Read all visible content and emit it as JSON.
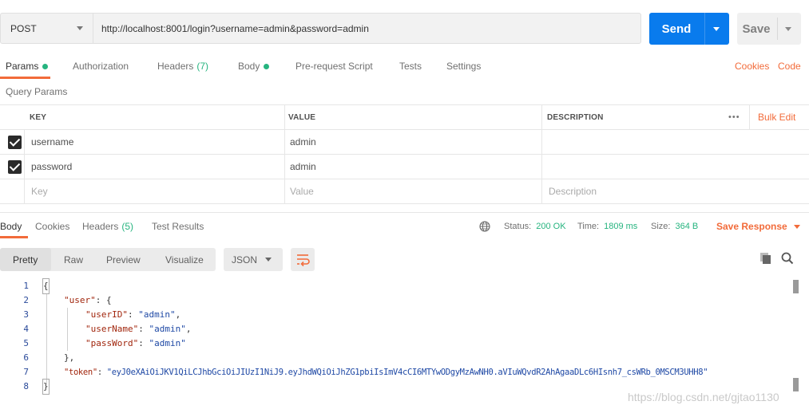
{
  "request": {
    "method": "POST",
    "url": "http://localhost:8001/login?username=admin&password=admin",
    "send_label": "Send",
    "save_label": "Save"
  },
  "request_tabs": [
    {
      "label": "Params",
      "dot": true,
      "active": true
    },
    {
      "label": "Authorization"
    },
    {
      "label": "Headers",
      "count": "(7)"
    },
    {
      "label": "Body",
      "dot": true
    },
    {
      "label": "Pre-request Script"
    },
    {
      "label": "Tests"
    },
    {
      "label": "Settings"
    }
  ],
  "right_links": {
    "cookies": "Cookies",
    "code": "Code"
  },
  "query_params": {
    "title": "Query Params",
    "headers": {
      "key": "KEY",
      "value": "VALUE",
      "description": "DESCRIPTION",
      "more": "•••",
      "bulk_edit": "Bulk Edit"
    },
    "rows": [
      {
        "key": "username",
        "value": "admin",
        "checked": true
      },
      {
        "key": "password",
        "value": "admin",
        "checked": true
      }
    ],
    "placeholders": {
      "key": "Key",
      "value": "Value",
      "description": "Description"
    }
  },
  "response_tabs": [
    {
      "label": "Body",
      "active": true
    },
    {
      "label": "Cookies"
    },
    {
      "label": "Headers",
      "count": "(5)"
    },
    {
      "label": "Test Results"
    }
  ],
  "status": {
    "status_label": "Status:",
    "status_value": "200 OK",
    "time_label": "Time:",
    "time_value": "1809 ms",
    "size_label": "Size:",
    "size_value": "364 B",
    "save_response": "Save Response"
  },
  "view": {
    "options": [
      "Pretty",
      "Raw",
      "Preview",
      "Visualize"
    ],
    "active": "Pretty",
    "format": "JSON"
  },
  "code": {
    "line_numbers": [
      "1",
      "2",
      "3",
      "4",
      "5",
      "6",
      "7",
      "8"
    ],
    "l1": "{",
    "l2_key": "\"user\"",
    "l2_rest": ": {",
    "l3_key": "\"userID\"",
    "l3_sep": ": ",
    "l3_val": "\"admin\"",
    "l3_end": ",",
    "l4_key": "\"userName\"",
    "l4_sep": ": ",
    "l4_val": "\"admin\"",
    "l4_end": ",",
    "l5_key": "\"passWord\"",
    "l5_sep": ": ",
    "l5_val": "\"admin\"",
    "l6": "},",
    "l7_key": "\"token\"",
    "l7_sep": ": ",
    "l7_val": "\"eyJ0eXAiOiJKV1QiLCJhbGciOiJIUzI1NiJ9.eyJhdWQiOiJhZG1pbiIsImV4cCI6MTYwODgyMzAwNH0.aVIuWQvdR2AhAgaaDLc6HIsnh7_csWRb_0MSCM3UHH8\"",
    "l8": "}"
  },
  "watermark": "https://blog.csdn.net/gjtao1130"
}
